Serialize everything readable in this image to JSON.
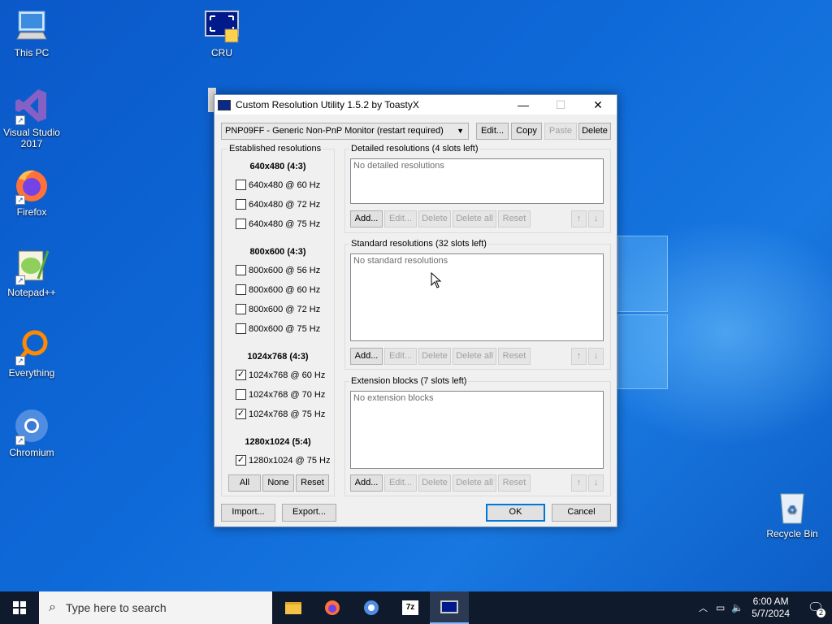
{
  "desktop": {
    "icons": [
      {
        "label": "This PC",
        "icon": "computer-icon"
      },
      {
        "label": "CRU",
        "icon": "monitor-icon"
      },
      {
        "label": "Visual Studio 2017",
        "icon": "visual-studio-icon"
      },
      {
        "label": "Firefox",
        "icon": "firefox-icon"
      },
      {
        "label": "Notepad++",
        "icon": "notepadpp-icon"
      },
      {
        "label": "Everything",
        "icon": "search-icon"
      },
      {
        "label": "Chromium",
        "icon": "chromium-icon"
      },
      {
        "label": "Recycle Bin",
        "icon": "recycle-bin-icon"
      }
    ]
  },
  "window": {
    "title": "Custom Resolution Utility 1.5.2 by ToastyX",
    "monitor_select": "PNP09FF - Generic Non-PnP Monitor (restart required)",
    "top_buttons": {
      "edit": "Edit...",
      "copy": "Copy",
      "paste": "Paste",
      "delete": "Delete"
    },
    "established": {
      "title": "Established resolutions",
      "sections": [
        {
          "header": "640x480 (4:3)",
          "items": [
            {
              "label": "640x480 @ 60 Hz",
              "checked": false
            },
            {
              "label": "640x480 @ 72 Hz",
              "checked": false
            },
            {
              "label": "640x480 @ 75 Hz",
              "checked": false
            }
          ]
        },
        {
          "header": "800x600 (4:3)",
          "items": [
            {
              "label": "800x600 @ 56 Hz",
              "checked": false
            },
            {
              "label": "800x600 @ 60 Hz",
              "checked": false
            },
            {
              "label": "800x600 @ 72 Hz",
              "checked": false
            },
            {
              "label": "800x600 @ 75 Hz",
              "checked": false
            }
          ]
        },
        {
          "header": "1024x768 (4:3)",
          "items": [
            {
              "label": "1024x768 @ 60 Hz",
              "checked": true
            },
            {
              "label": "1024x768 @ 70 Hz",
              "checked": false
            },
            {
              "label": "1024x768 @ 75 Hz",
              "checked": true
            }
          ]
        },
        {
          "header": "1280x1024 (5:4)",
          "items": [
            {
              "label": "1280x1024 @ 75 Hz",
              "checked": true
            }
          ]
        }
      ],
      "buttons": {
        "all": "All",
        "none": "None",
        "reset": "Reset"
      }
    },
    "detailed": {
      "title": "Detailed resolutions (4 slots left)",
      "empty": "No detailed resolutions"
    },
    "standard": {
      "title": "Standard resolutions (32 slots left)",
      "empty": "No standard resolutions"
    },
    "extension": {
      "title": "Extension blocks (7 slots left)",
      "empty": "No extension blocks"
    },
    "list_buttons": {
      "add": "Add...",
      "edit": "Edit...",
      "delete": "Delete",
      "delete_all": "Delete all",
      "reset": "Reset",
      "up": "↑",
      "down": "↓"
    },
    "bottom": {
      "import": "Import...",
      "export": "Export...",
      "ok": "OK",
      "cancel": "Cancel"
    }
  },
  "taskbar": {
    "search_placeholder": "Type here to search",
    "time": "6:00 AM",
    "date": "5/7/2024",
    "notifications": "2"
  }
}
